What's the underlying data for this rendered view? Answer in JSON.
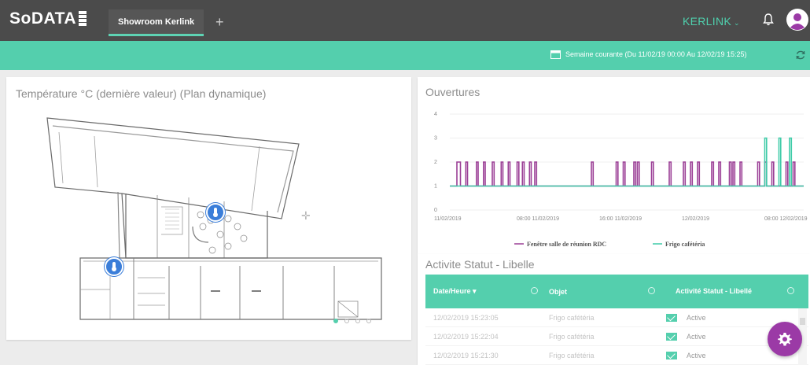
{
  "app": {
    "logo": "SoDATA",
    "tab_active": "Showroom Kerlink",
    "tab_add": "+",
    "brand": "KERLINK",
    "brand_caret": "⌄"
  },
  "subbar": {
    "period": "Semaine courante (Du 11/02/19 00:00 Au 12/02/19 15:25)"
  },
  "panels": {
    "temp_title": "Température °C (dernière valeur) (Plan dynamique)",
    "open_title": "Ouvertures",
    "status_title": "Activite Statut - Libelle"
  },
  "chart_data": {
    "type": "line",
    "title": "Ouvertures",
    "y_ticks": [
      "0",
      "1",
      "2",
      "3",
      "4"
    ],
    "ylim": [
      0,
      4
    ],
    "x_ticks": [
      "11/02/2019",
      "08:00 11/02/2019",
      "16:00 11/02/2019",
      "12/02/2019",
      "08:00 12/02/2019"
    ],
    "series": [
      {
        "name": "Fenêtre salle de réunion RDC",
        "color": "#9b3f96",
        "x": [
          0.02,
          0.03,
          0.045,
          0.05,
          0.075,
          0.08,
          0.095,
          0.1,
          0.12,
          0.125,
          0.145,
          0.15,
          0.165,
          0.17,
          0.19,
          0.195,
          0.205,
          0.21,
          0.225,
          0.23,
          0.24,
          0.245,
          0.4,
          0.405,
          0.47,
          0.475,
          0.49,
          0.495,
          0.52,
          0.525,
          0.53,
          0.535,
          0.57,
          0.575,
          0.62,
          0.625,
          0.66,
          0.665,
          0.68,
          0.685,
          0.7,
          0.705,
          0.74,
          0.745,
          0.76,
          0.765,
          0.79,
          0.795,
          0.8,
          0.805,
          0.82,
          0.825,
          0.87,
          0.875,
          0.89,
          0.895,
          0.91,
          0.915,
          0.95,
          0.955,
          0.97,
          0.975
        ],
        "y_hi": 2,
        "y_lo": 1
      },
      {
        "name": "Frigo cafétéria",
        "color": "#3fcba8",
        "x": [
          0.89,
          0.895,
          0.93,
          0.935,
          0.96,
          0.965
        ],
        "y_hi": 3,
        "y_lo": 1
      }
    ]
  },
  "status_table": {
    "columns": [
      "Date/Heure ▾",
      "Objet",
      "Activité Statut - Libellé"
    ],
    "rows": [
      {
        "date": "12/02/2019 15:23:05",
        "object": "Frigo cafétéria",
        "status": "Active"
      },
      {
        "date": "12/02/2019 15:22:04",
        "object": "Frigo cafétéria",
        "status": "Active"
      },
      {
        "date": "12/02/2019 15:21:30",
        "object": "Frigo cafétéria",
        "status": "Active"
      }
    ]
  },
  "colors": {
    "accent": "#54cfad",
    "topbar": "#4b4b4b",
    "fab": "#9b3aa6",
    "pin": "#3b7ed9"
  }
}
